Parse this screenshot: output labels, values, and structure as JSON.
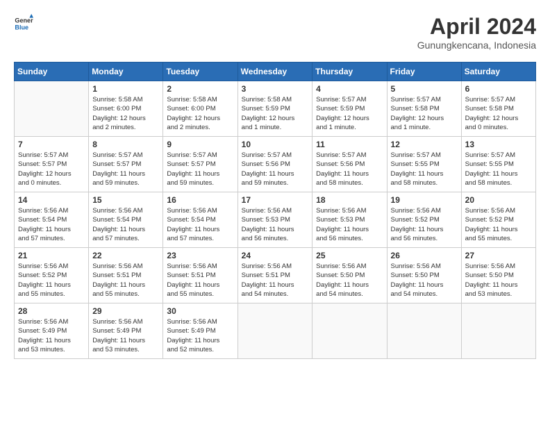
{
  "logo": {
    "text_general": "General",
    "text_blue": "Blue"
  },
  "title": "April 2024",
  "location": "Gunungkencana, Indonesia",
  "days_of_week": [
    "Sunday",
    "Monday",
    "Tuesday",
    "Wednesday",
    "Thursday",
    "Friday",
    "Saturday"
  ],
  "weeks": [
    [
      {
        "day": "",
        "info": ""
      },
      {
        "day": "1",
        "info": "Sunrise: 5:58 AM\nSunset: 6:00 PM\nDaylight: 12 hours\nand 2 minutes."
      },
      {
        "day": "2",
        "info": "Sunrise: 5:58 AM\nSunset: 6:00 PM\nDaylight: 12 hours\nand 2 minutes."
      },
      {
        "day": "3",
        "info": "Sunrise: 5:58 AM\nSunset: 5:59 PM\nDaylight: 12 hours\nand 1 minute."
      },
      {
        "day": "4",
        "info": "Sunrise: 5:57 AM\nSunset: 5:59 PM\nDaylight: 12 hours\nand 1 minute."
      },
      {
        "day": "5",
        "info": "Sunrise: 5:57 AM\nSunset: 5:58 PM\nDaylight: 12 hours\nand 1 minute."
      },
      {
        "day": "6",
        "info": "Sunrise: 5:57 AM\nSunset: 5:58 PM\nDaylight: 12 hours\nand 0 minutes."
      }
    ],
    [
      {
        "day": "7",
        "info": "Sunrise: 5:57 AM\nSunset: 5:57 PM\nDaylight: 12 hours\nand 0 minutes."
      },
      {
        "day": "8",
        "info": "Sunrise: 5:57 AM\nSunset: 5:57 PM\nDaylight: 11 hours\nand 59 minutes."
      },
      {
        "day": "9",
        "info": "Sunrise: 5:57 AM\nSunset: 5:57 PM\nDaylight: 11 hours\nand 59 minutes."
      },
      {
        "day": "10",
        "info": "Sunrise: 5:57 AM\nSunset: 5:56 PM\nDaylight: 11 hours\nand 59 minutes."
      },
      {
        "day": "11",
        "info": "Sunrise: 5:57 AM\nSunset: 5:56 PM\nDaylight: 11 hours\nand 58 minutes."
      },
      {
        "day": "12",
        "info": "Sunrise: 5:57 AM\nSunset: 5:55 PM\nDaylight: 11 hours\nand 58 minutes."
      },
      {
        "day": "13",
        "info": "Sunrise: 5:57 AM\nSunset: 5:55 PM\nDaylight: 11 hours\nand 58 minutes."
      }
    ],
    [
      {
        "day": "14",
        "info": "Sunrise: 5:56 AM\nSunset: 5:54 PM\nDaylight: 11 hours\nand 57 minutes."
      },
      {
        "day": "15",
        "info": "Sunrise: 5:56 AM\nSunset: 5:54 PM\nDaylight: 11 hours\nand 57 minutes."
      },
      {
        "day": "16",
        "info": "Sunrise: 5:56 AM\nSunset: 5:54 PM\nDaylight: 11 hours\nand 57 minutes."
      },
      {
        "day": "17",
        "info": "Sunrise: 5:56 AM\nSunset: 5:53 PM\nDaylight: 11 hours\nand 56 minutes."
      },
      {
        "day": "18",
        "info": "Sunrise: 5:56 AM\nSunset: 5:53 PM\nDaylight: 11 hours\nand 56 minutes."
      },
      {
        "day": "19",
        "info": "Sunrise: 5:56 AM\nSunset: 5:52 PM\nDaylight: 11 hours\nand 56 minutes."
      },
      {
        "day": "20",
        "info": "Sunrise: 5:56 AM\nSunset: 5:52 PM\nDaylight: 11 hours\nand 55 minutes."
      }
    ],
    [
      {
        "day": "21",
        "info": "Sunrise: 5:56 AM\nSunset: 5:52 PM\nDaylight: 11 hours\nand 55 minutes."
      },
      {
        "day": "22",
        "info": "Sunrise: 5:56 AM\nSunset: 5:51 PM\nDaylight: 11 hours\nand 55 minutes."
      },
      {
        "day": "23",
        "info": "Sunrise: 5:56 AM\nSunset: 5:51 PM\nDaylight: 11 hours\nand 55 minutes."
      },
      {
        "day": "24",
        "info": "Sunrise: 5:56 AM\nSunset: 5:51 PM\nDaylight: 11 hours\nand 54 minutes."
      },
      {
        "day": "25",
        "info": "Sunrise: 5:56 AM\nSunset: 5:50 PM\nDaylight: 11 hours\nand 54 minutes."
      },
      {
        "day": "26",
        "info": "Sunrise: 5:56 AM\nSunset: 5:50 PM\nDaylight: 11 hours\nand 54 minutes."
      },
      {
        "day": "27",
        "info": "Sunrise: 5:56 AM\nSunset: 5:50 PM\nDaylight: 11 hours\nand 53 minutes."
      }
    ],
    [
      {
        "day": "28",
        "info": "Sunrise: 5:56 AM\nSunset: 5:49 PM\nDaylight: 11 hours\nand 53 minutes."
      },
      {
        "day": "29",
        "info": "Sunrise: 5:56 AM\nSunset: 5:49 PM\nDaylight: 11 hours\nand 53 minutes."
      },
      {
        "day": "30",
        "info": "Sunrise: 5:56 AM\nSunset: 5:49 PM\nDaylight: 11 hours\nand 52 minutes."
      },
      {
        "day": "",
        "info": ""
      },
      {
        "day": "",
        "info": ""
      },
      {
        "day": "",
        "info": ""
      },
      {
        "day": "",
        "info": ""
      }
    ]
  ]
}
